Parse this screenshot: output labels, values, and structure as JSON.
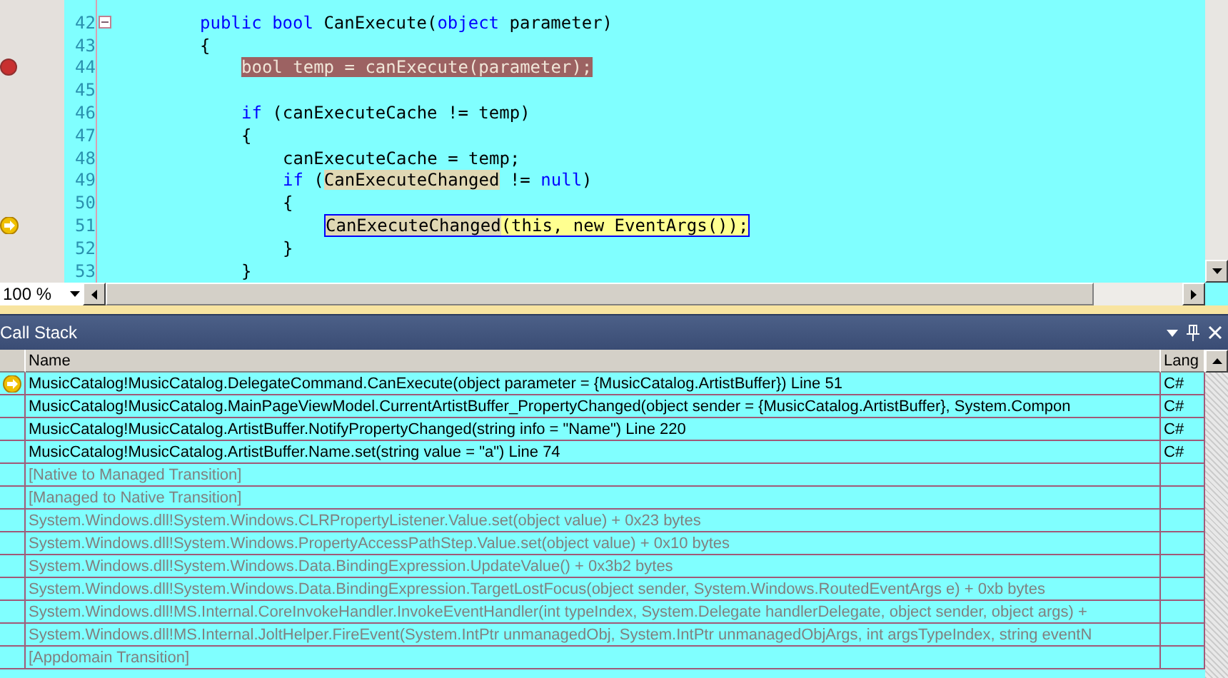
{
  "editor": {
    "lines": [
      {
        "number": "42",
        "breakpoint": false,
        "current": false,
        "collapsible": true,
        "segments": [
          {
            "text": "public bool",
            "kind": "keyword"
          },
          {
            "text": " CanExecute(",
            "kind": "plain"
          },
          {
            "text": "object",
            "kind": "keyword"
          },
          {
            "text": " parameter)",
            "kind": "plain"
          }
        ]
      },
      {
        "number": "43",
        "breakpoint": false,
        "current": false,
        "collapsible": false,
        "segments": [
          {
            "text": "{",
            "kind": "plain"
          }
        ],
        "children": [
          {
            "number": "44",
            "breakpoint": true,
            "current": false,
            "collapsible": false,
            "segments": [
              {
                "text": "bool temp = canExecute(parameter);",
                "kind": "breakpoint"
              }
            ]
          },
          {
            "number": "45",
            "breakpoint": false,
            "current": false,
            "collapsible": false
          },
          {
            "number": "46",
            "breakpoint": false,
            "current": false,
            "collapsible": false,
            "segments": [
              {
                "text": "if",
                "kind": "keyword"
              },
              {
                "text": " (canExecuteCache != temp)",
                "kind": "plain"
              }
            ]
          },
          {
            "number": "47",
            "breakpoint": false,
            "current": false,
            "collapsible": false,
            "segments": [
              {
                "text": "{",
                "kind": "plain"
              }
            ],
            "children": [
              {
                "number": "48",
                "breakpoint": false,
                "current": false,
                "collapsible": false,
                "segments": [
                  {
                    "text": "canExecuteCache = temp;",
                    "kind": "plain"
                  }
                ]
              },
              {
                "number": "49",
                "breakpoint": false,
                "current": false,
                "collapsible": false,
                "segments": [
                  {
                    "text": "if",
                    "kind": "keyword"
                  },
                  {
                    "text": " (",
                    "kind": "plain"
                  },
                  {
                    "text": "CanExecuteChanged",
                    "kind": "reference"
                  },
                  {
                    "text": " != ",
                    "kind": "plain"
                  },
                  {
                    "text": "null",
                    "kind": "keyword"
                  },
                  {
                    "text": ")",
                    "kind": "plain"
                  }
                ]
              },
              {
                "number": "50",
                "breakpoint": false,
                "current": false,
                "collapsible": false,
                "segments": [
                  {
                    "text": "{",
                    "kind": "plain"
                  }
                ],
                "children": [
                  {
                    "number": "51",
                    "breakpoint": false,
                    "current": true,
                    "collapsible": false,
                    "segments": [
                      {
                        "text": "CanExecuteChanged",
                        "kind": "current-reference"
                      },
                      {
                        "text": "(this, new EventArgs());",
                        "kind": "current"
                      }
                    ]
                  }
                ]
              },
              {
                "number": "52",
                "breakpoint": false,
                "current": false,
                "collapsible": false,
                "segments": [
                  {
                    "text": "}",
                    "kind": "plain"
                  }
                ]
              }
            ]
          },
          {
            "number": "53",
            "breakpoint": false,
            "current": false,
            "collapsible": false,
            "segments": [
              {
                "text": "}",
                "kind": "plain"
              }
            ]
          }
        ]
      }
    ],
    "zoom": "100 %"
  },
  "call_stack": {
    "title": "Call Stack",
    "columns": [
      "Name",
      "Lang"
    ],
    "rows": [
      {
        "name": "MusicCatalog!MusicCatalog.DelegateCommand.CanExecute(object parameter = {MusicCatalog.ArtistBuffer}) Line 51",
        "language": "C#",
        "current": true,
        "external": false
      },
      {
        "name": "MusicCatalog!MusicCatalog.MainPageViewModel.CurrentArtistBuffer_PropertyChanged(object sender = {MusicCatalog.ArtistBuffer}, System.Compon",
        "language": "C#",
        "current": false,
        "external": false
      },
      {
        "name": "MusicCatalog!MusicCatalog.ArtistBuffer.NotifyPropertyChanged(string info = \"Name\") Line 220",
        "language": "C#",
        "current": false,
        "external": false
      },
      {
        "name": "MusicCatalog!MusicCatalog.ArtistBuffer.Name.set(string value = \"a\") Line 74",
        "language": "C#",
        "current": false,
        "external": false
      },
      {
        "name": "[Native to Managed Transition]",
        "current": false,
        "external": true
      },
      {
        "name": "[Managed to Native Transition]",
        "current": false,
        "external": true
      },
      {
        "name": "System.Windows.dll!System.Windows.CLRPropertyListener.Value.set(object value) + 0x23 bytes",
        "current": false,
        "external": true
      },
      {
        "name": "System.Windows.dll!System.Windows.PropertyAccessPathStep.Value.set(object value) + 0x10 bytes",
        "current": false,
        "external": true
      },
      {
        "name": "System.Windows.dll!System.Windows.Data.BindingExpression.UpdateValue() + 0x3b2 bytes",
        "current": false,
        "external": true
      },
      {
        "name": "System.Windows.dll!System.Windows.Data.BindingExpression.TargetLostFocus(object sender, System.Windows.RoutedEventArgs e) + 0xb bytes",
        "current": false,
        "external": true
      },
      {
        "name": "System.Windows.dll!MS.Internal.CoreInvokeHandler.InvokeEventHandler(int typeIndex, System.Delegate handlerDelegate, object sender, object args) +",
        "current": false,
        "external": true
      },
      {
        "name": "System.Windows.dll!MS.Internal.JoltHelper.FireEvent(System.IntPtr unmanagedObj, System.IntPtr unmanagedObjArgs, int argsTypeIndex, string eventN",
        "current": false,
        "external": true
      },
      {
        "name": "[Appdomain Transition]",
        "current": false,
        "external": true
      }
    ]
  }
}
